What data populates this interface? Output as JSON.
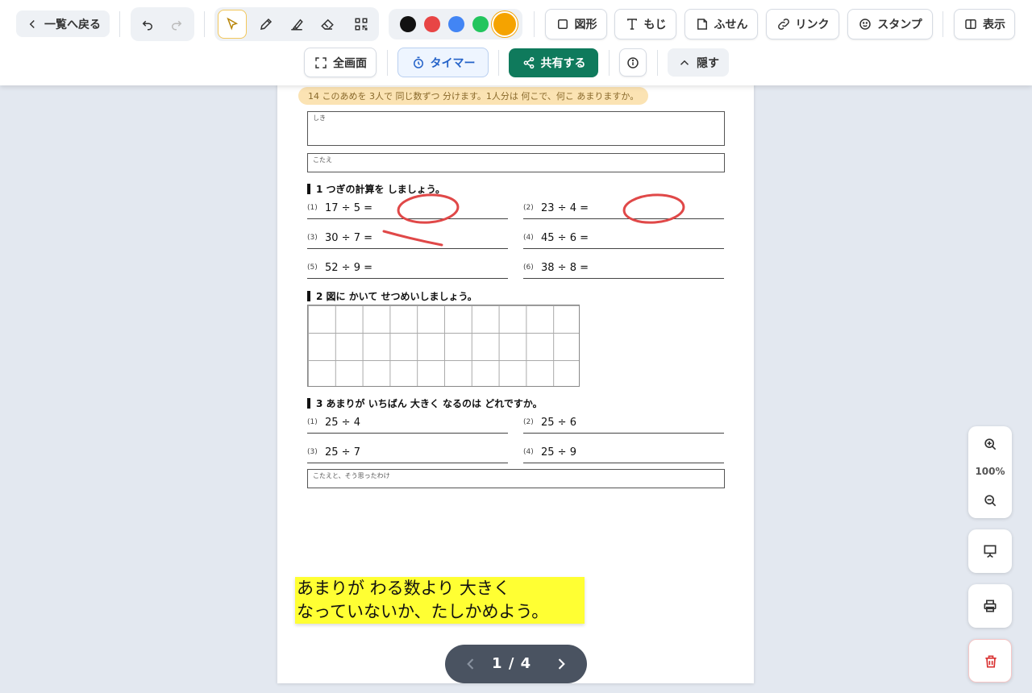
{
  "toolbar": {
    "back_label": "一覧へ戻る",
    "colors": [
      "#111111",
      "#e84545",
      "#4285f4",
      "#22c55e",
      "#f5a300"
    ],
    "selected_color": "#f5a300",
    "shape_label": "図形",
    "text_label": "もじ",
    "sticky_label": "ふせん",
    "link_label": "リンク",
    "stamp_label": "スタンプ",
    "display_label": "表示",
    "fullscreen_label": "全画面",
    "timer_label": "タイマー",
    "share_label": "共有する",
    "hide_label": "隠す"
  },
  "worksheet": {
    "q14_text": "14 このあめを 3人で 同じ数ずつ 分けます。1人分は 何こで、何こ あまりますか。",
    "shiki_label": "しき",
    "kotae_label": "こたえ",
    "section1_title": "1 つぎの計算を しましょう。",
    "section1_problems": [
      {
        "num": "(1)",
        "expr": "17 ÷ 5 ="
      },
      {
        "num": "(2)",
        "expr": "23 ÷ 4 ="
      },
      {
        "num": "(3)",
        "expr": "30 ÷ 7 ="
      },
      {
        "num": "(4)",
        "expr": "45 ÷ 6 ="
      },
      {
        "num": "(5)",
        "expr": "52 ÷ 9 ="
      },
      {
        "num": "(6)",
        "expr": "38 ÷ 8 ="
      }
    ],
    "section2_title": "2 図に かいて せつめいしましょう。",
    "section3_title": "3 あまりが いちばん 大きく なるのは どれですか。",
    "section3_problems": [
      {
        "num": "(1)",
        "expr": "25 ÷ 4"
      },
      {
        "num": "(2)",
        "expr": "25 ÷ 6"
      },
      {
        "num": "(3)",
        "expr": "25 ÷ 7"
      },
      {
        "num": "(4)",
        "expr": "25 ÷ 9"
      }
    ],
    "reason_label": "こたえと、そう思ったわけ",
    "ink_color": "#e04848"
  },
  "sticky_note": {
    "line1": "あまりが わる数より 大きく",
    "line2": "なっていないか、たしかめよう。",
    "color": "#ffff33"
  },
  "pager": {
    "current": "1",
    "separator": "/",
    "total": "4"
  },
  "zoom": {
    "level": "100%"
  }
}
